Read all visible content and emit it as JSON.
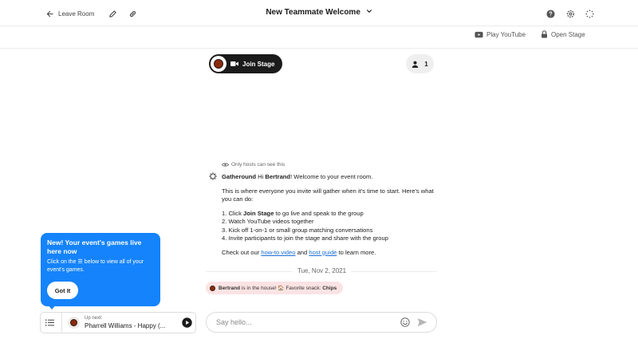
{
  "header": {
    "leave_label": "Leave Room",
    "room_title": "New Teammate Welcome",
    "play_youtube_label": "Play YouTube",
    "open_stage_label": "Open Stage"
  },
  "stage": {
    "join_label": "Join Stage",
    "participant_count": "1"
  },
  "chat": {
    "hosts_note": "Only hosts can see this",
    "sender": "Gatheround",
    "greeting_pre": " Hi ",
    "greeting_name": "Bertrand",
    "greeting_post": "! Welcome to your event room.",
    "intro": "This is where everyone you invite will gather when it's time to start. Here's what you can do:",
    "item1_pre": "1. Click ",
    "item1_bold": "Join Stage",
    "item1_post": " to go live and speak to the group",
    "item2": "2. Watch YouTube videos together",
    "item3": "3. Kick off 1-on-1 or small group matching conversations",
    "item4": "4. Invite participants to join the stage and share with the group",
    "outro_pre": "Check out our ",
    "link1": "how-to video",
    "outro_mid": " and ",
    "link2": "host guide",
    "outro_post": " to learn more.",
    "date": "Tue, Nov 2, 2021",
    "arrival_name": "Bertrand",
    "arrival_text": " is in the house! 🏠 Favorite snack: ",
    "arrival_snack": "Chips",
    "input_placeholder": "Say hello..."
  },
  "tooltip": {
    "title": "New! Your event's games live here now",
    "body": "Click on the ☰ below to view all of your event's games.",
    "button": "Got It"
  },
  "up_next": {
    "label": "Up next:",
    "song": "Pharrell Williams - Happy (..."
  },
  "colors": {
    "accent_blue": "#1583fb",
    "dark_pill": "#1b1b1b",
    "arrival_bg": "#fbe3e4",
    "link": "#1a6fd4"
  }
}
